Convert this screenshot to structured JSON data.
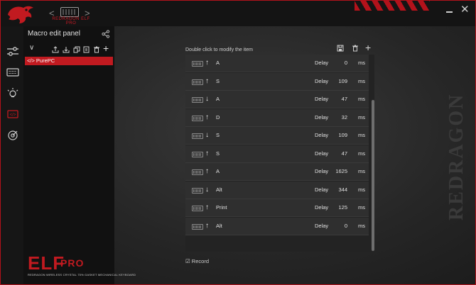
{
  "header": {
    "device_name": "REDRAGON ELF PRO",
    "prev_label": "<",
    "next_label": ">",
    "close_label": "✕"
  },
  "nav": {
    "icons": [
      "sliders-icon",
      "keyboard-icon",
      "lighting-icon",
      "macro-icon",
      "target-icon"
    ],
    "active": "macro-icon"
  },
  "panel": {
    "title": "Macro edit panel",
    "collapse_label": "∨",
    "add_label": "+",
    "macros": [
      {
        "label": "</> PurePC"
      }
    ],
    "brand_logo": {
      "text": "ELF",
      "suffix": "PRO",
      "subtitle": "REDRAGON WIRELESS CRYSTAL 75% GASKET MECHANICAL KEYBOARD"
    }
  },
  "main": {
    "hint": "Double click to modify the item",
    "add_label": "+",
    "delay_label": "Delay",
    "unit_label": "ms",
    "record_label": "☑ Record",
    "events": [
      {
        "dir": "↑",
        "key": "A",
        "delay": "0"
      },
      {
        "dir": "↑",
        "key": "S",
        "delay": "109"
      },
      {
        "dir": "↓",
        "key": "A",
        "delay": "47"
      },
      {
        "dir": "↑",
        "key": "D",
        "delay": "32"
      },
      {
        "dir": "↓",
        "key": "S",
        "delay": "109"
      },
      {
        "dir": "↑",
        "key": "S",
        "delay": "47"
      },
      {
        "dir": "↑",
        "key": "A",
        "delay": "1625"
      },
      {
        "dir": "↓",
        "key": "Alt",
        "delay": "344"
      },
      {
        "dir": "↑",
        "key": "Print",
        "delay": "125"
      },
      {
        "dir": "↑",
        "key": "Alt",
        "delay": "0"
      }
    ]
  },
  "watermark": "REDRAGON",
  "colors": {
    "accent": "#c11a20",
    "background": "#262626",
    "row": "#2f2f2f"
  }
}
